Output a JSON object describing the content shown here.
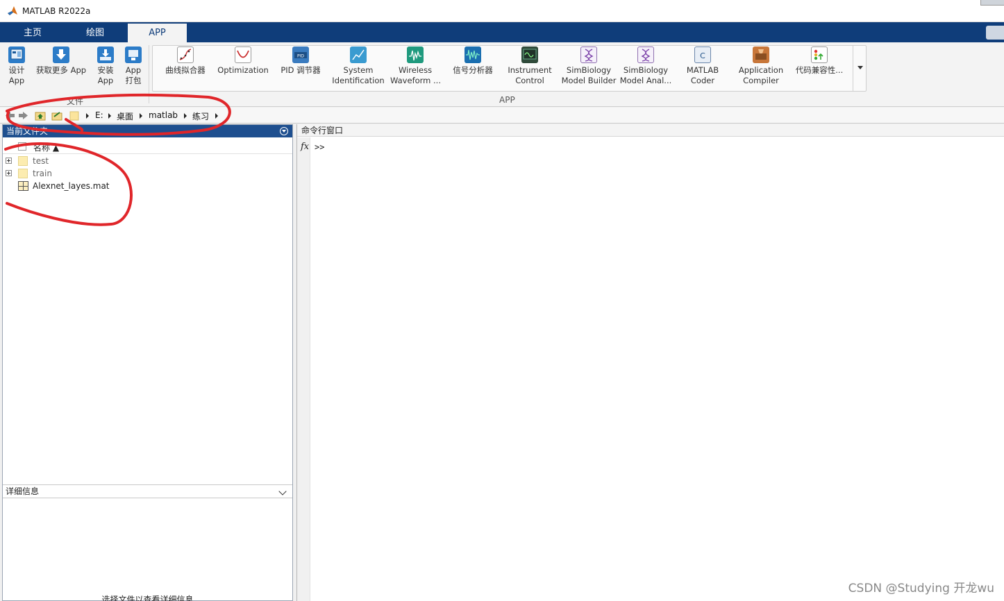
{
  "window": {
    "title": "MATLAB R2022a"
  },
  "tabs": [
    {
      "label": "主页",
      "active": false
    },
    {
      "label": "绘图",
      "active": false
    },
    {
      "label": "APP",
      "active": true
    }
  ],
  "ribbon": {
    "file_section_label": "文件",
    "file_buttons": [
      {
        "label": "设计\nApp",
        "icon": "design-app-icon"
      },
      {
        "label": "获取更多 App",
        "icon": "get-more-apps-icon"
      },
      {
        "label": "安装\nApp",
        "icon": "install-app-icon"
      },
      {
        "label": "App\n打包",
        "icon": "package-app-icon"
      }
    ],
    "app_section_label": "APP",
    "apps": [
      {
        "label": "曲线拟合器",
        "icon": "curve-fitter-icon"
      },
      {
        "label": "Optimization",
        "icon": "optimization-icon"
      },
      {
        "label": "PID 调节器",
        "icon": "pid-tuner-icon"
      },
      {
        "label": "System\nIdentification",
        "icon": "system-identification-icon"
      },
      {
        "label": "Wireless\nWaveform ...",
        "icon": "wireless-waveform-icon"
      },
      {
        "label": "信号分析器",
        "icon": "signal-analyzer-icon"
      },
      {
        "label": "Instrument\nControl",
        "icon": "instrument-control-icon"
      },
      {
        "label": "SimBiology\nModel Builder",
        "icon": "simbiology-builder-icon"
      },
      {
        "label": "SimBiology\nModel Anal...",
        "icon": "simbiology-analyzer-icon"
      },
      {
        "label": "MATLAB\nCoder",
        "icon": "matlab-coder-icon"
      },
      {
        "label": "Application\nCompiler",
        "icon": "application-compiler-icon"
      },
      {
        "label": "代码兼容性...",
        "icon": "code-compatibility-icon"
      }
    ]
  },
  "address_bar": {
    "crumbs": [
      "E:",
      "桌面",
      "matlab",
      "练习"
    ]
  },
  "current_folder": {
    "title": "当前文件夹",
    "column_name": "名称 ▲",
    "items": [
      {
        "name": "test",
        "type": "folder"
      },
      {
        "name": "train",
        "type": "folder"
      },
      {
        "name": "Alexnet_layes.mat",
        "type": "mat"
      }
    ],
    "details_title": "详细信息",
    "details_hint": "选择文件以查看详细信息"
  },
  "command_window": {
    "title": "命令行窗口",
    "fx": "fx",
    "prompt": ">>"
  },
  "watermark": "CSDN @Studying 开龙wu",
  "colors": {
    "tabstrip": "#0f3d7a",
    "panel_header": "#1e4f8f",
    "annotation": "#e0262a"
  }
}
